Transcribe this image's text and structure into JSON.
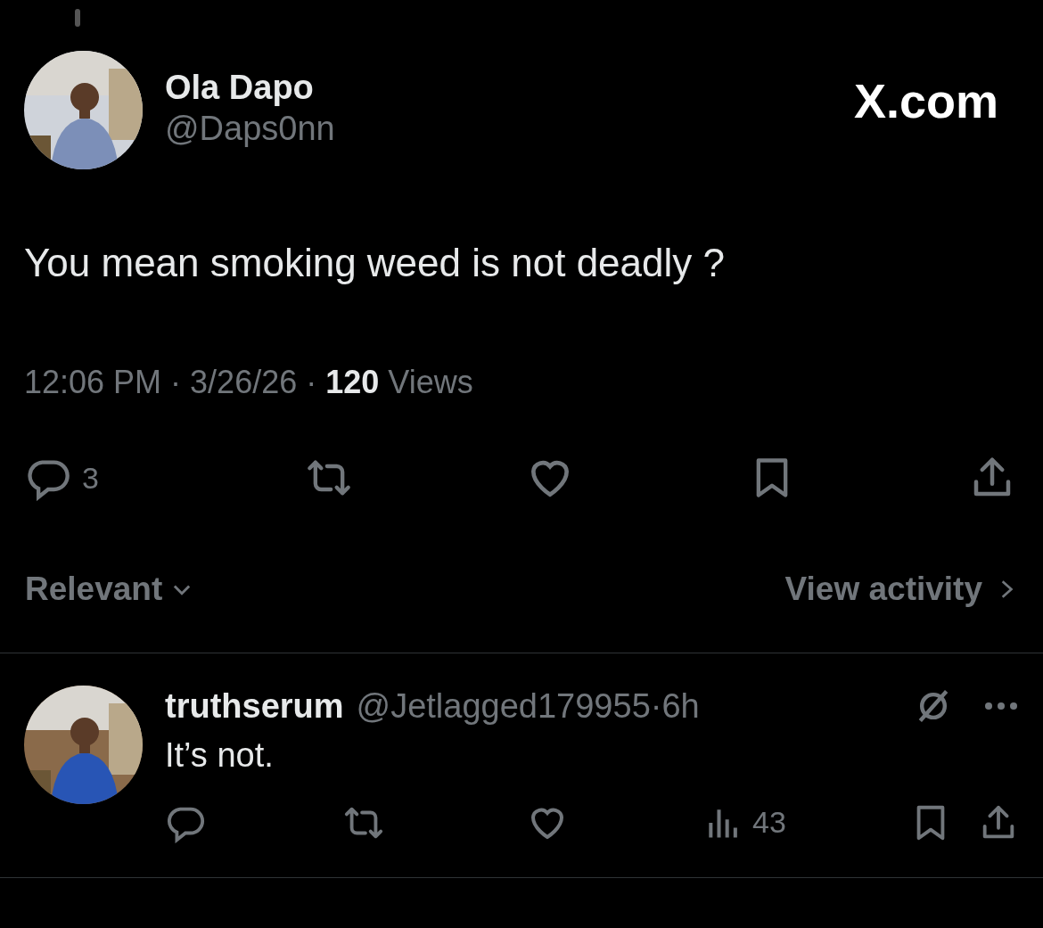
{
  "tweet": {
    "author_name": "Ola Dapo",
    "author_handle": "@Daps0nn",
    "site_label": "X.com",
    "text": "You mean smoking weed is not deadly ?",
    "time": "12:06 PM",
    "time_separator": "·",
    "date": "3/26/26",
    "date_separator": "·",
    "views_count": "120",
    "views_label": "Views",
    "reply_count": "3"
  },
  "sort": {
    "label": "Relevant",
    "activity_label": "View activity"
  },
  "replies": [
    {
      "author_name": "truthserum",
      "author_handle": "@Jetlagged179955",
      "age_separator": "·",
      "age": "6h",
      "text": "It’s not.",
      "views": "43"
    }
  ]
}
